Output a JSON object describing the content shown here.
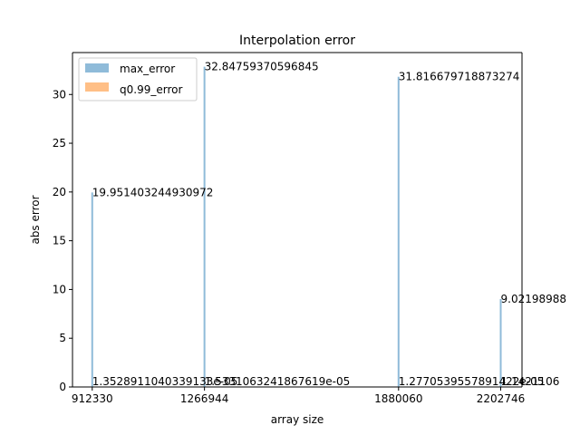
{
  "chart_data": {
    "type": "bar",
    "title": "Interpolation error",
    "xlabel": "array size",
    "ylabel": "abs error",
    "x": [
      912330,
      1266944,
      1880060,
      2202746
    ],
    "xlim": [
      850000,
      2270000
    ],
    "ylim": [
      0,
      34.3
    ],
    "yticks": [
      0,
      5,
      10,
      15,
      20,
      25,
      30
    ],
    "grid": false,
    "legend_position": "top-left",
    "series": [
      {
        "name": "max_error",
        "color": "#1f77b4",
        "values": [
          19.951403244930972,
          32.84759370596845,
          31.816679718873274,
          9.02198988
        ]
      },
      {
        "name": "q0.99_error",
        "color": "#ff7f0e",
        "values": [
          1.3528911040339133e-05,
          1.533106324186762e-05,
          1.2770539557891423e-05,
          1.1421106e-05
        ]
      }
    ],
    "data_labels": {
      "max_error": [
        "19.951403244930972",
        "32.84759370596845",
        "31.816679718873274",
        "9.02198988"
      ],
      "q0.99_error": [
        "1.3528911040339133e-05",
        "1.5331063241867619e-05",
        "1.2770539557891422e-05",
        "1.1421106"
      ]
    }
  }
}
